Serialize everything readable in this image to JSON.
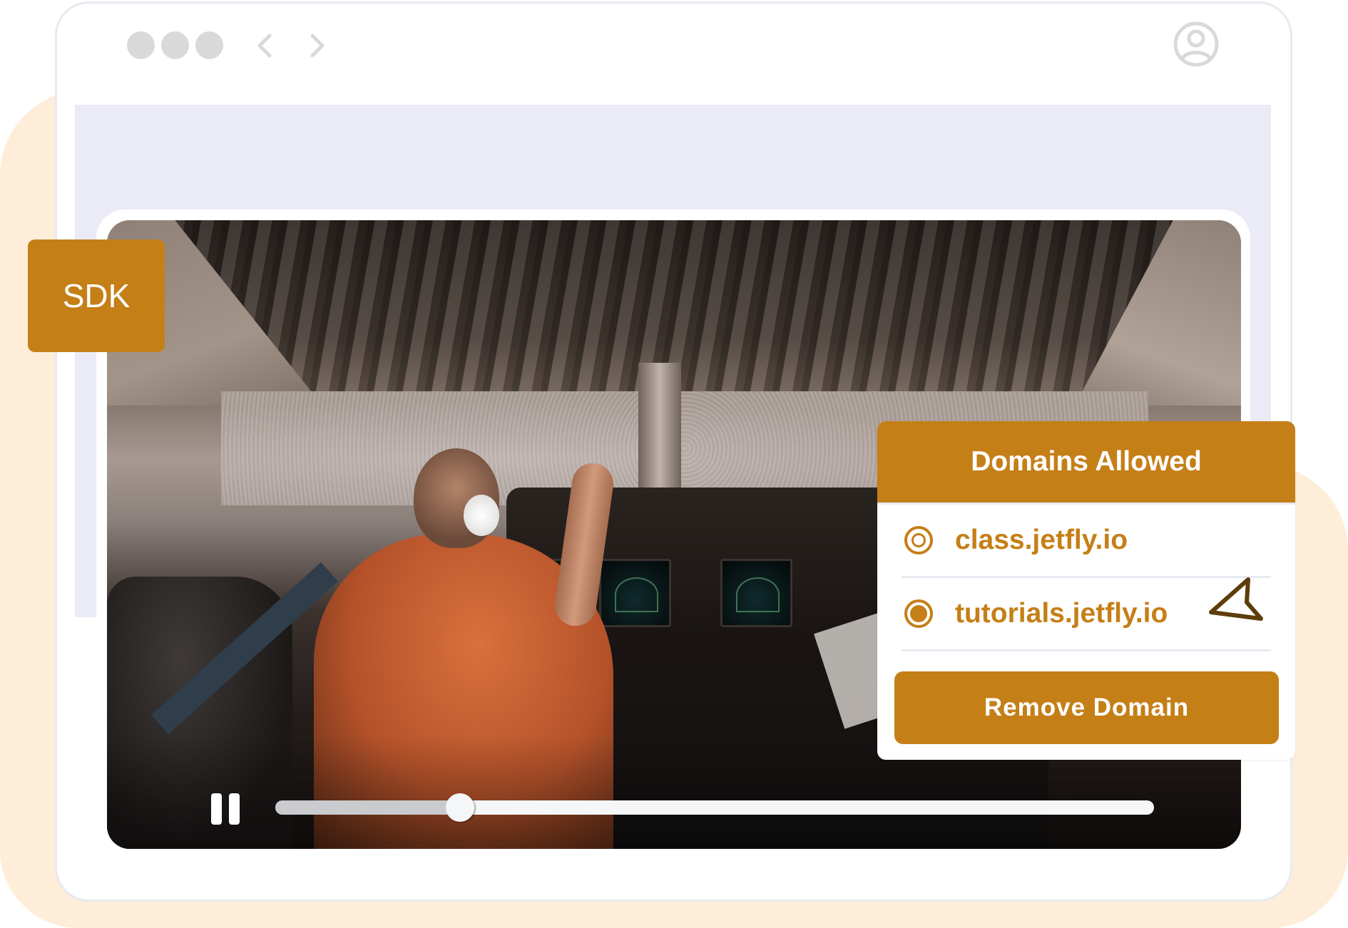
{
  "colors": {
    "accent": "#C57F17",
    "peach": "#FEEDD8",
    "lavender": "#EBEBF7",
    "window_border": "#E7EAF0",
    "chrome_icon": "#D9D9D9",
    "cursor": "#5E3D0C"
  },
  "browser": {
    "window_controls": [
      "dot",
      "dot",
      "dot"
    ],
    "back_icon": "chevron-left-icon",
    "forward_icon": "chevron-right-icon",
    "account_icon": "user-circle-icon"
  },
  "badge": {
    "label": "SDK"
  },
  "video": {
    "description": "Pilot in airplane cockpit above clouds",
    "state": "playing",
    "control_icon": "pause-icon",
    "progress_percent": 21
  },
  "domains_panel": {
    "title": "Domains Allowed",
    "items": [
      {
        "label": "class.jetfly.io",
        "selected": false
      },
      {
        "label": "tutorials.jetfly.io",
        "selected": true
      }
    ],
    "remove_button": "Remove Domain"
  }
}
